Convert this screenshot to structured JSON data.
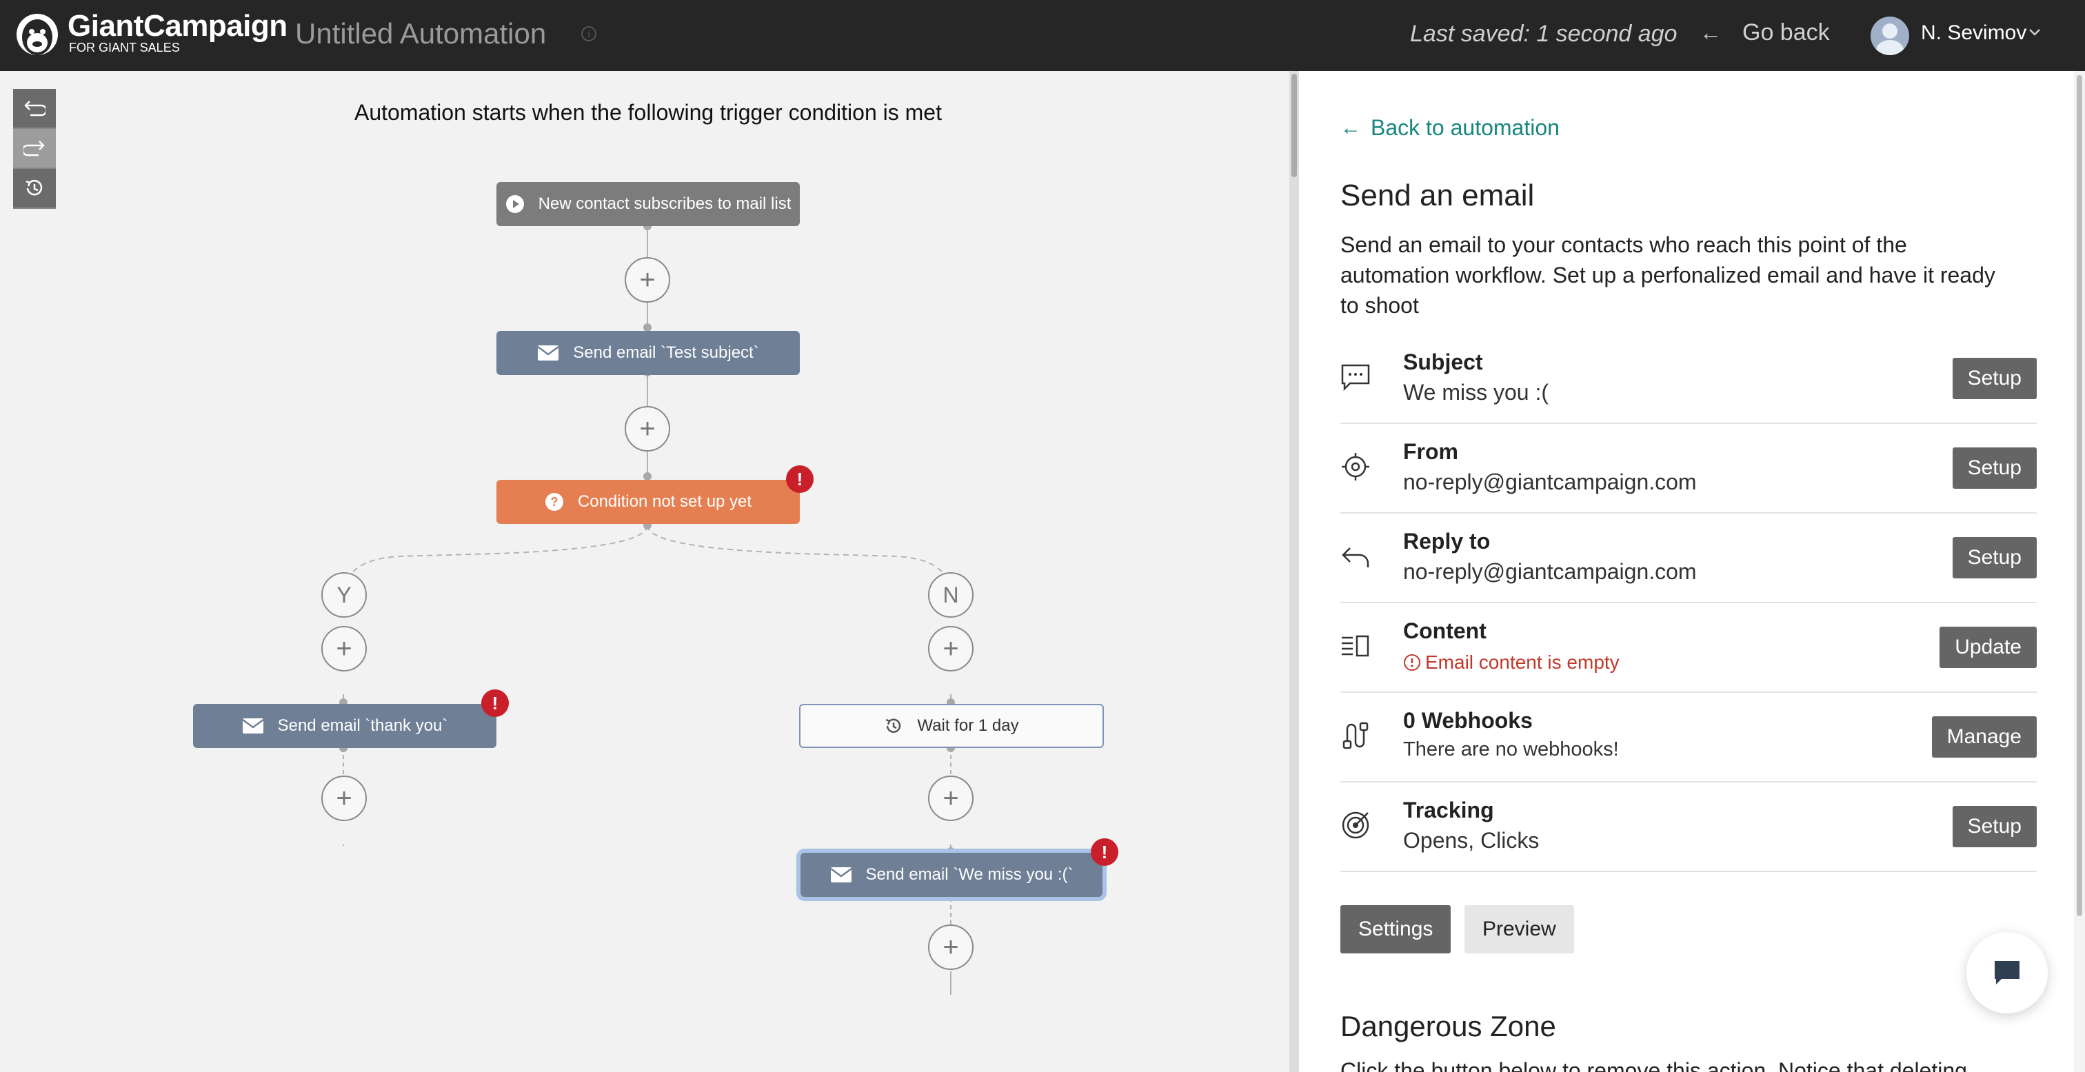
{
  "header": {
    "brand": "GiantCampaign",
    "tagline": "FOR GIANT SALES",
    "title": "Untitled Automation",
    "last_saved": "Last saved: 1 second ago",
    "go_back": "Go back",
    "user_name": "N. Sevimov"
  },
  "canvas": {
    "trigger_caption": "Automation starts when the following trigger condition is met",
    "nodes": {
      "trigger": "New contact subscribes to mail list",
      "email_test": "Send email `Test subject`",
      "condition": "Condition not set up yet",
      "email_thanks": "Send email `thank you`",
      "wait": "Wait for 1 day",
      "email_miss": "Send email `We miss you :(`"
    },
    "branch_yes": "Y",
    "branch_no": "N",
    "plus": "+",
    "error_mark": "!"
  },
  "panel": {
    "back_link": "Back to automation",
    "title": "Send an email",
    "description": "Send an email to your contacts who reach this point of the automation workflow. Set up a perfonalized email and have it ready to shoot",
    "rows": [
      {
        "label": "Subject",
        "value": "We miss you :(",
        "button": "Setup",
        "icon": "message-icon"
      },
      {
        "label": "From",
        "value": "no-reply@giantcampaign.com",
        "button": "Setup",
        "icon": "target-icon"
      },
      {
        "label": "Reply to",
        "value": "no-reply@giantcampaign.com",
        "button": "Setup",
        "icon": "reply-icon"
      },
      {
        "label": "Content",
        "value": "Email content is empty",
        "button": "Update",
        "icon": "content-icon"
      },
      {
        "label": "0 Webhooks",
        "value": "There are no webhooks!",
        "button": "Manage",
        "icon": "webhook-icon"
      },
      {
        "label": "Tracking",
        "value": "Opens, Clicks",
        "button": "Setup",
        "icon": "tracking-icon"
      }
    ],
    "settings_button": "Settings",
    "preview_button": "Preview",
    "danger_title": "Dangerous Zone",
    "danger_text": "Click the button below to remove this action. Notice that deleting"
  },
  "colors": {
    "accent_teal": "#17867f",
    "condition_orange": "#e57f51",
    "node_slate": "#6e7f96",
    "error_red": "#c81f2a"
  }
}
